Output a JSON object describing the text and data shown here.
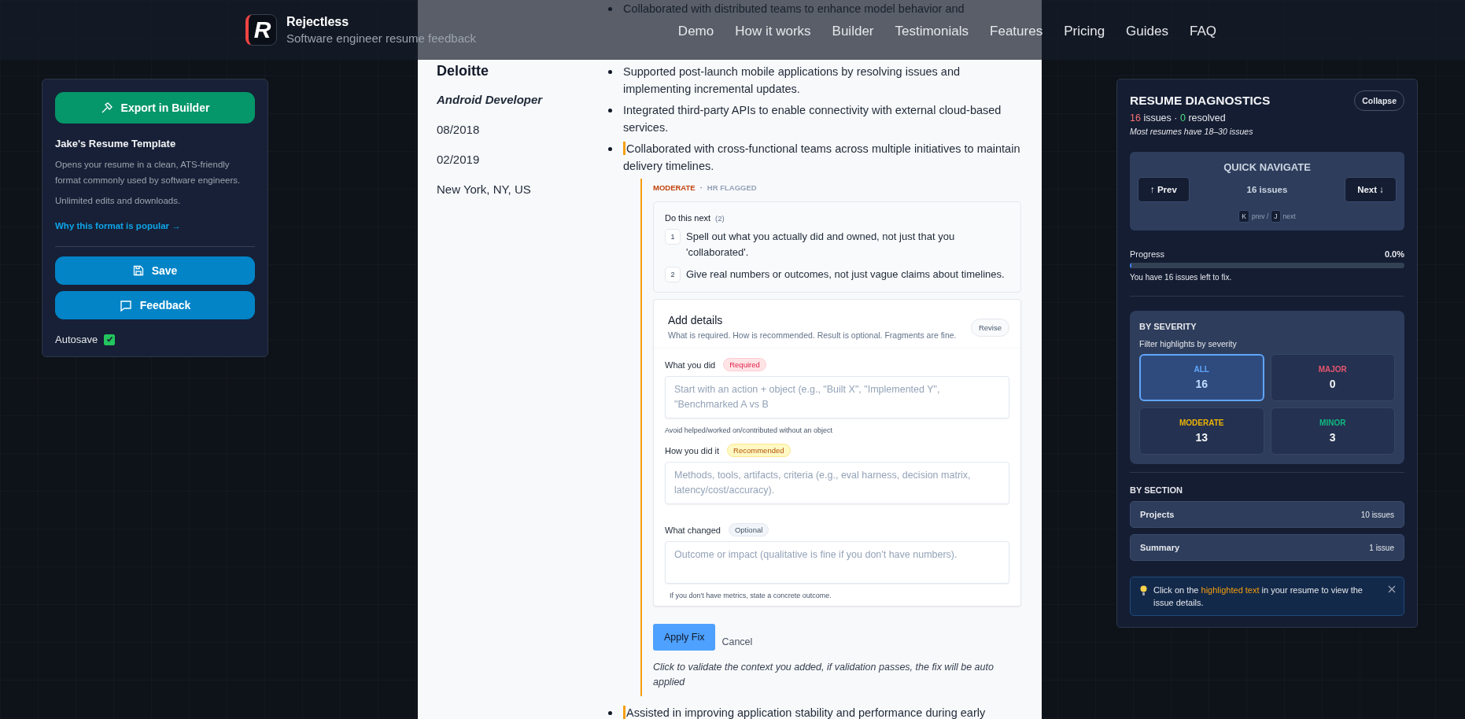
{
  "header": {
    "logo_mark": "R",
    "brand": "Rejectless",
    "tagline": "Software engineer resume feedback",
    "nav": [
      "Demo",
      "How it works",
      "Builder",
      "Testimonials",
      "Features",
      "Pricing",
      "Guides",
      "FAQ"
    ]
  },
  "left_panel": {
    "export_button": "Export in Builder",
    "template_title": "Jake's Resume Template",
    "description": "Opens your resume in a clean, ATS-friendly format commonly used by software engineers.",
    "note": "Unlimited edits and downloads.",
    "link": "Why this format is popular →",
    "buttons": [
      {
        "kind": "save",
        "label": "Save"
      },
      {
        "kind": "feedback",
        "label": "Feedback"
      }
    ],
    "autosave": {
      "label": "Autosave",
      "checked": true
    }
  },
  "resume": {
    "partial_bullet": "Collaborated with distributed teams to enhance model behavior and",
    "company": "Deloitte",
    "role": "Android Developer",
    "start_date": "08/2018",
    "end_date": "02/2019",
    "location": "New York, NY, US",
    "bullets": [
      {
        "text": "Supported post-launch mobile applications by resolving issues and implementing incremental updates.",
        "flagged": false
      },
      {
        "text": "Integrated third-party APIs to enable connectivity with external cloud-based services.",
        "flagged": false
      },
      {
        "text": "Collaborated with cross-functional teams across multiple initiatives to maintain delivery timelines.",
        "flagged": true
      }
    ],
    "issue": {
      "severity": "MODERATE",
      "separator": "·",
      "flag": "HR FLAGGED",
      "steps_title": "Do this next",
      "steps_count": "(2)",
      "steps": [
        {
          "number": "1",
          "text": "Spell out what you actually did and owned, not just that you 'collaborated'."
        },
        {
          "number": "2",
          "text": "Give real numbers or outcomes, not just vague claims about timelines."
        }
      ],
      "details": {
        "title": "Add details",
        "subtitle": "What is required. How is recommended. Result is optional. Fragments are fine.",
        "revise_button": "Revise",
        "fields": [
          {
            "label": "What you did",
            "badge": "Required",
            "kind": "required",
            "placeholder": "Start with an action + object (e.g., \"Built X\", \"Implemented Y\", \"Benchmarked A vs B",
            "hint": "Avoid helped/worked on/contributed without an object"
          },
          {
            "label": "How you did it",
            "badge": "Recommended",
            "kind": "recommended",
            "placeholder": "Methods, tools, artifacts, criteria (e.g., eval harness, decision matrix, latency/cost/accuracy)."
          },
          {
            "label": "What changed",
            "badge": "Optional",
            "kind": "optional",
            "placeholder": "Outcome or impact (qualitative is fine if you don't have numbers).",
            "hint": "If you don't have metrics, state a concrete outcome."
          }
        ]
      },
      "apply_button": "Apply Fix",
      "cancel_link": "Cancel",
      "apply_note": "Click to validate the context you added, if validation passes, the fix will be auto applied"
    },
    "trailing_bullet": {
      "text": "Assisted in improving application stability and performance during early",
      "flagged": true
    }
  },
  "diagnostics": {
    "title": "RESUME DIAGNOSTICS",
    "collapse_button": "Collapse",
    "issue_count": "16",
    "issue_word": "issues",
    "separator": "·",
    "resolved_count": "0",
    "resolved_word": "resolved",
    "benchmark": "Most resumes have 18–30 issues",
    "quick_navigate": {
      "title": "QUICK NAVIGATE",
      "prev_button": "↑ Prev",
      "count": "16 issues",
      "next_button": "Next ↓",
      "shortcuts": [
        {
          "key": "K",
          "label": "prev /"
        },
        {
          "key": "J",
          "label": "next"
        }
      ]
    },
    "progress": {
      "label": "Progress",
      "value": "0.0%",
      "level": 0,
      "message": "You have 16 issues left to fix."
    },
    "by_severity": {
      "title": "BY SEVERITY",
      "subtitle": "Filter highlights by severity",
      "filters": [
        {
          "label": "ALL",
          "count": "16",
          "selected": true,
          "color": "#60a5fa"
        },
        {
          "label": "MAJOR",
          "count": "0",
          "selected": false,
          "color": "#e5566f"
        },
        {
          "label": "MODERATE",
          "count": "13",
          "selected": false,
          "color": "#eab308"
        },
        {
          "label": "MINOR",
          "count": "3",
          "selected": false,
          "color": "#10b981"
        }
      ]
    },
    "by_section": {
      "title": "BY SECTION",
      "sections": [
        {
          "name": "Projects",
          "count": "10 issues"
        },
        {
          "name": "Summary",
          "count": "1 issue"
        }
      ]
    },
    "tip": {
      "text": "Click on the **highlighted text** in your resume to view the issue details."
    }
  }
}
